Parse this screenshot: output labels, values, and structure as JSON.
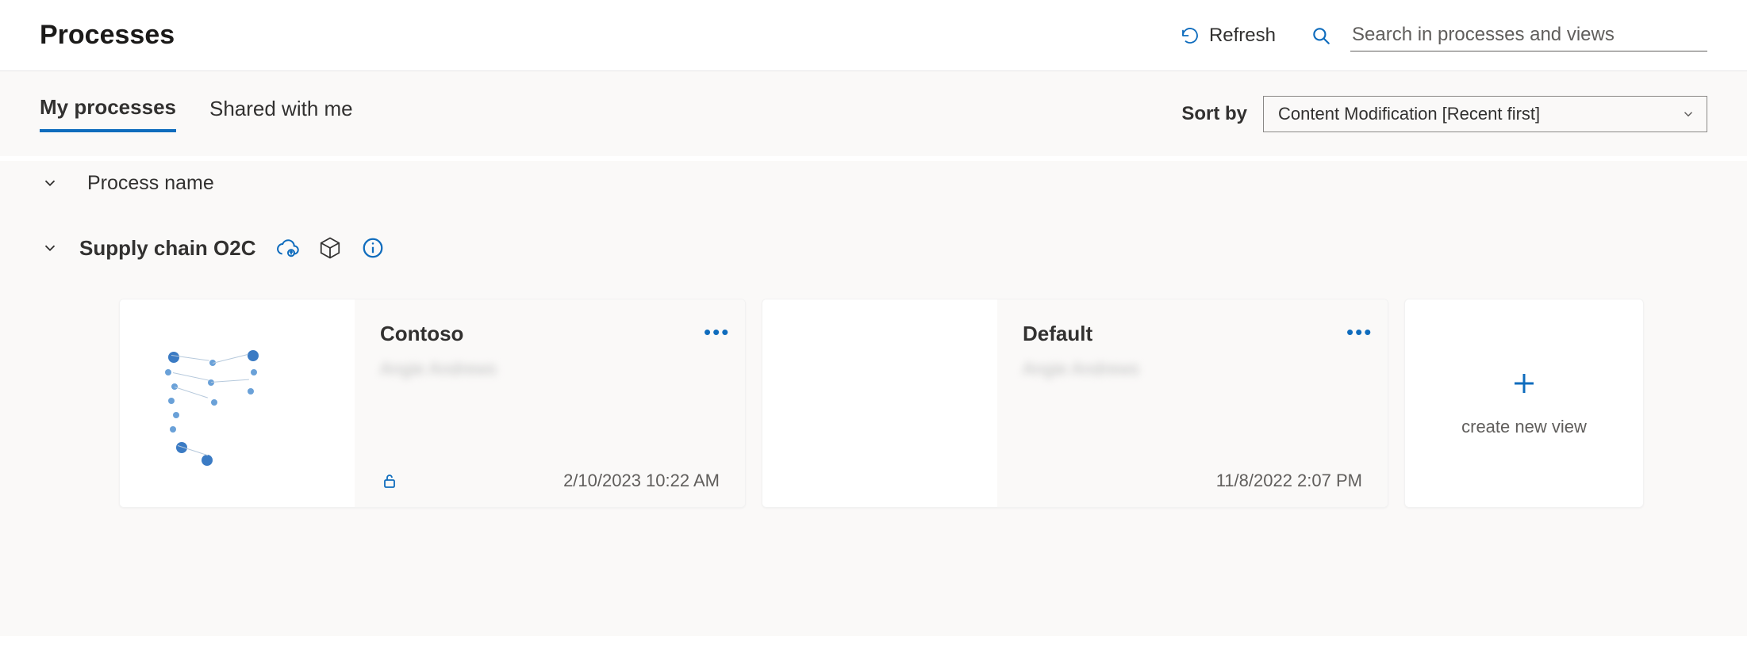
{
  "header": {
    "title": "Processes",
    "refresh_label": "Refresh",
    "search_placeholder": "Search in processes and views"
  },
  "tabs": {
    "my_label": "My processes",
    "shared_label": "Shared with me",
    "active": "my"
  },
  "sort": {
    "label": "Sort by",
    "selected": "Content Modification [Recent first]"
  },
  "group": {
    "column_header": "Process name",
    "process_name": "Supply chain O2C"
  },
  "cards": [
    {
      "title": "Contoso",
      "owner": "Angie Andrews",
      "date": "2/10/2023 10:22 AM",
      "has_lock": true,
      "has_thumb": true
    },
    {
      "title": "Default",
      "owner": "Angie Andrews",
      "date": "11/8/2022 2:07 PM",
      "has_lock": false,
      "has_thumb": false
    }
  ],
  "new_card": {
    "label": "create new view"
  }
}
